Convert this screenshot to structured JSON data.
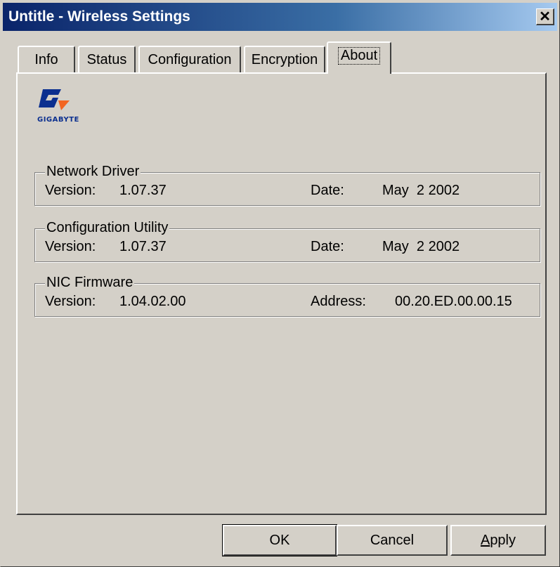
{
  "window": {
    "title": "Untitle - Wireless Settings",
    "close_label": "✕"
  },
  "tabs": [
    {
      "label": "Info"
    },
    {
      "label": "Status"
    },
    {
      "label": "Configuration"
    },
    {
      "label": "Encryption"
    },
    {
      "label": "About"
    }
  ],
  "active_tab": "About",
  "logo": {
    "text": "GIGABYTE",
    "icon": "gigabyte-logo"
  },
  "groups": {
    "network_driver": {
      "title": "Network Driver",
      "version_label": "Version:",
      "version": "1.07.37",
      "date_label": "Date:",
      "date": "May  2 2002"
    },
    "configuration_utility": {
      "title": "Configuration Utility",
      "version_label": "Version:",
      "version": "1.07.37",
      "date_label": "Date:",
      "date": "May  2 2002"
    },
    "nic_firmware": {
      "title": "NIC Firmware",
      "version_label": "Version:",
      "version": "1.04.02.00",
      "address_label": "Address:",
      "address": "00.20.ED.00.00.15"
    }
  },
  "buttons": {
    "ok": "OK",
    "cancel": "Cancel",
    "apply": "Apply"
  },
  "colors": {
    "title_start": "#0a246a",
    "title_end": "#a6caf0",
    "face": "#d4d0c8",
    "logo_blue": "#0b2f8f",
    "logo_orange": "#f26522"
  }
}
